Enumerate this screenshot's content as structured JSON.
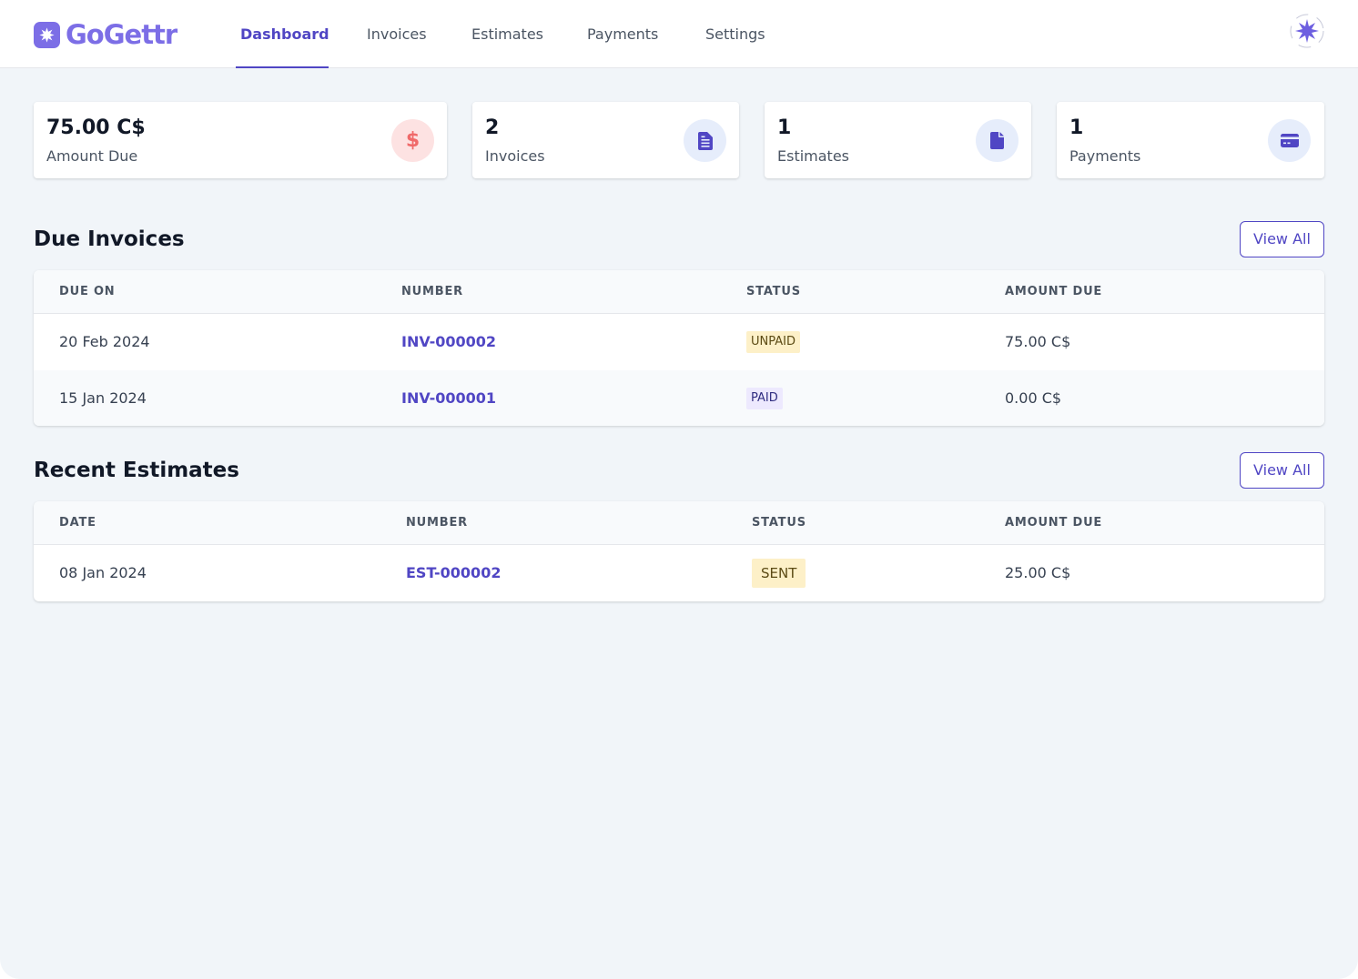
{
  "app": {
    "brand": "GoGettr"
  },
  "nav": {
    "tabs": [
      {
        "label": "Dashboard",
        "active": true
      },
      {
        "label": "Invoices"
      },
      {
        "label": "Estimates"
      },
      {
        "label": "Payments"
      },
      {
        "label": "Settings"
      }
    ]
  },
  "stats": [
    {
      "value": "75.00 C$",
      "label": "Amount Due",
      "icon": "dollar-icon"
    },
    {
      "value": "2",
      "label": "Invoices",
      "icon": "document-list-icon"
    },
    {
      "value": "1",
      "label": "Estimates",
      "icon": "document-icon"
    },
    {
      "value": "1",
      "label": "Payments",
      "icon": "credit-card-icon"
    }
  ],
  "due_invoices": {
    "title": "Due Invoices",
    "view_all": "View All",
    "columns": [
      "DUE ON",
      "NUMBER",
      "STATUS",
      "AMOUNT DUE"
    ],
    "rows": [
      {
        "date": "20 Feb 2024",
        "number": "INV-000002",
        "status": "UNPAID",
        "amount": "75.00 C$"
      },
      {
        "date": "15 Jan 2024",
        "number": "INV-000001",
        "status": "PAID",
        "amount": "0.00 C$"
      }
    ]
  },
  "recent_estimates": {
    "title": "Recent Estimates",
    "view_all": "View All",
    "columns": [
      "DATE",
      "NUMBER",
      "STATUS",
      "AMOUNT DUE"
    ],
    "rows": [
      {
        "date": "08 Jan 2024",
        "number": "EST-000002",
        "status": "SENT",
        "amount": "25.00 C$"
      }
    ]
  },
  "colors": {
    "accent": "#5046c4",
    "brand": "#7c6ee6",
    "unpaid_badge": "#fdf0c8",
    "paid_badge": "#ede9fe",
    "danger_icon_bg": "#fde2e2",
    "info_icon_bg": "#e6edfb"
  }
}
